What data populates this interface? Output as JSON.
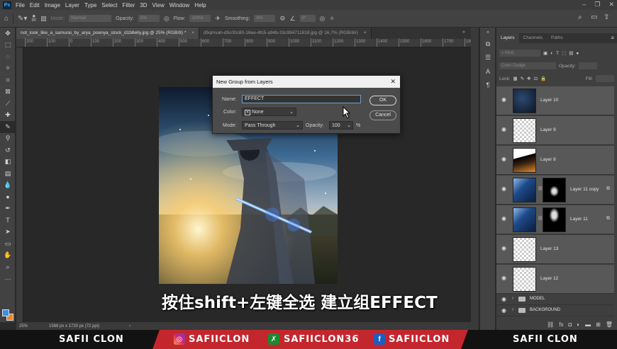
{
  "menu": {
    "items": [
      "File",
      "Edit",
      "Image",
      "Layer",
      "Type",
      "Select",
      "Filter",
      "3D",
      "View",
      "Window",
      "Help"
    ]
  },
  "options": {
    "brush_size": "80",
    "mode_label": "Mode:",
    "mode_value": "Normal",
    "opacity_label": "Opacity:",
    "opacity_value": "0%",
    "flow_label": "Flow:",
    "flow_value": "100%",
    "smoothing_label": "Smoothing:",
    "smoothing_value": "0%",
    "angle_value": "0°"
  },
  "tabs": [
    {
      "label": "not_look_like_a_samurai_by_arya_poenya_stock_d1b8elly.jpg @ 25% (RGB/8) *",
      "active": true
    },
    {
      "label": "d5qmvah-d5c00c80-16ee-4fc5-a94b-33c994711818.jpg @ 16,7% (RGB/8#)",
      "active": false
    }
  ],
  "ruler": {
    "labels": [
      "200",
      "100",
      "0",
      "100",
      "200",
      "300",
      "400",
      "500",
      "600",
      "700",
      "800",
      "900",
      "1000",
      "1100",
      "1200",
      "1300",
      "1400",
      "1500",
      "1600",
      "1700",
      "1800"
    ]
  },
  "dialog": {
    "title": "New Group from Layers",
    "name_label": "Name:",
    "name_value": "EFFECT",
    "color_label": "Color:",
    "color_value": "None",
    "mode_label": "Mode:",
    "mode_value": "Pass Through",
    "opacity_label": "Opacity:",
    "opacity_value": "100",
    "opacity_unit": "%",
    "ok_label": "OK",
    "cancel_label": "Cancel"
  },
  "subtitle": "按住shift+左键全选 建立组EFFECT",
  "status": {
    "zoom": "25%",
    "doc_info": "1568 px x 1730 px (72 ppi)"
  },
  "panel": {
    "tabs": [
      {
        "label": "Layers",
        "active": true
      },
      {
        "label": "Channels",
        "active": false
      },
      {
        "label": "Paths",
        "active": false
      }
    ],
    "kind_label": "Kind",
    "blend_mode": "Color Dodge",
    "opacity_label": "Opacity:",
    "lock_label": "Lock:",
    "fill_label": "Fill:",
    "layers": [
      {
        "name": "Layer 10",
        "thumb": "dark-blue"
      },
      {
        "name": "Layer 9",
        "thumb": "transparent"
      },
      {
        "name": "Layer 8",
        "thumb": "orange"
      },
      {
        "name": "Layer 11 copy",
        "thumb": "blue-effect",
        "mask": true
      },
      {
        "name": "Layer 11",
        "thumb": "blue-effect",
        "mask": true
      },
      {
        "name": "Layer 13",
        "thumb": "transparent"
      },
      {
        "name": "Layer 12",
        "thumb": "transparent"
      }
    ],
    "groups": [
      {
        "name": "MODEL"
      },
      {
        "name": "BACKGROUND"
      }
    ]
  },
  "banner": {
    "left_name": "SAFII CLON",
    "instagram": "SAFIICLON",
    "xbox": "SAFIICLON36",
    "facebook": "SAFIICLON",
    "right_name": "SAFII CLON",
    "colors": {
      "red": "#c4262d",
      "dark": "#121212"
    }
  }
}
